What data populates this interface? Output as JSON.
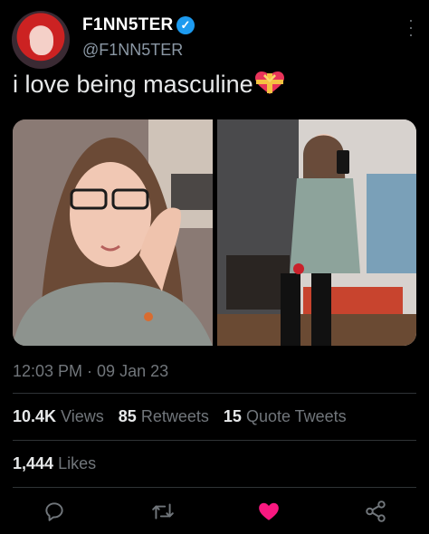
{
  "user": {
    "display_name": "F1NN5TER",
    "handle": "@F1NN5TER",
    "verified_icon": "verified-badge-icon"
  },
  "tweet": {
    "text": "i love being masculine",
    "emoji": "heart-with-ribbon-emoji",
    "timestamp": "12:03 PM · 09 Jan 23"
  },
  "media": {
    "photos": [
      {
        "alt": "selfie with glasses"
      },
      {
        "alt": "mirror selfie"
      }
    ]
  },
  "stats": {
    "views_count": "10.4K",
    "views_label": "Views",
    "retweets_count": "85",
    "retweets_label": "Retweets",
    "quotes_count": "15",
    "quotes_label": "Quote Tweets",
    "likes_count": "1,444",
    "likes_label": "Likes"
  },
  "actions": [
    {
      "name": "reply-icon"
    },
    {
      "name": "retweet-icon"
    },
    {
      "name": "like-icon",
      "active": true,
      "color": "#f91880"
    },
    {
      "name": "share-icon"
    }
  ],
  "colors": {
    "background": "#000000",
    "text": "#e7e9ea",
    "muted": "#71767b",
    "verified": "#1d9bf0",
    "like": "#f91880"
  }
}
